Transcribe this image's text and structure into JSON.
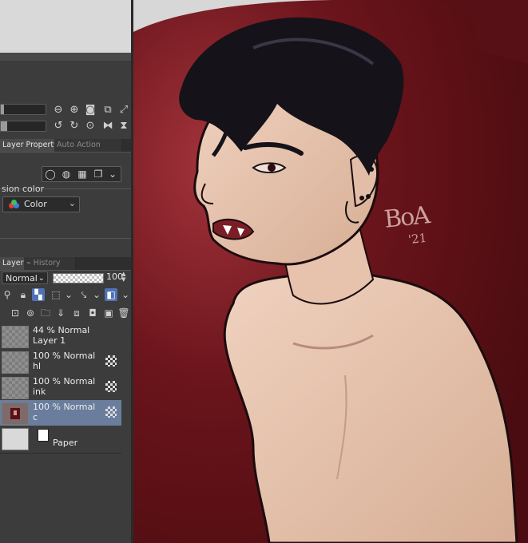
{
  "navigator": {
    "icons": [
      "zoom-out-icon",
      "zoom-in-icon",
      "fit-icon",
      "actual-size-icon",
      "fit-window-icon",
      "rotate-left-icon",
      "rotate-right-icon",
      "reset-rotation-icon",
      "flip-horizontal-icon",
      "flip-vertical-icon"
    ]
  },
  "property_tabs": [
    {
      "label": "Layer Property",
      "active": true
    },
    {
      "label": "Auto Action",
      "active": false
    }
  ],
  "layer_property": {
    "expression_color_label": "sion color",
    "color_select_value": "Color"
  },
  "layer_tabs": [
    {
      "label": "Layer",
      "active": true
    },
    {
      "label": "History",
      "active": false
    }
  ],
  "layer_toolbar": {
    "blend_mode": "Normal",
    "opacity_value": "100"
  },
  "layers": [
    {
      "opacity_mode": "44 % Normal",
      "name": "Layer 1",
      "selected": false
    },
    {
      "opacity_mode": "100 % Normal",
      "name": "hl",
      "selected": false
    },
    {
      "opacity_mode": "100 % Normal",
      "name": "ink",
      "selected": false
    },
    {
      "opacity_mode": "100 % Normal",
      "name": "c",
      "selected": true
    }
  ],
  "paper_layer": {
    "name": "Paper"
  },
  "artwork": {
    "signature": "BoA",
    "signature_year": "'21",
    "colors": {
      "background": "#5c0f14",
      "skin": "#dfb9a2",
      "hair": "#151219"
    }
  }
}
